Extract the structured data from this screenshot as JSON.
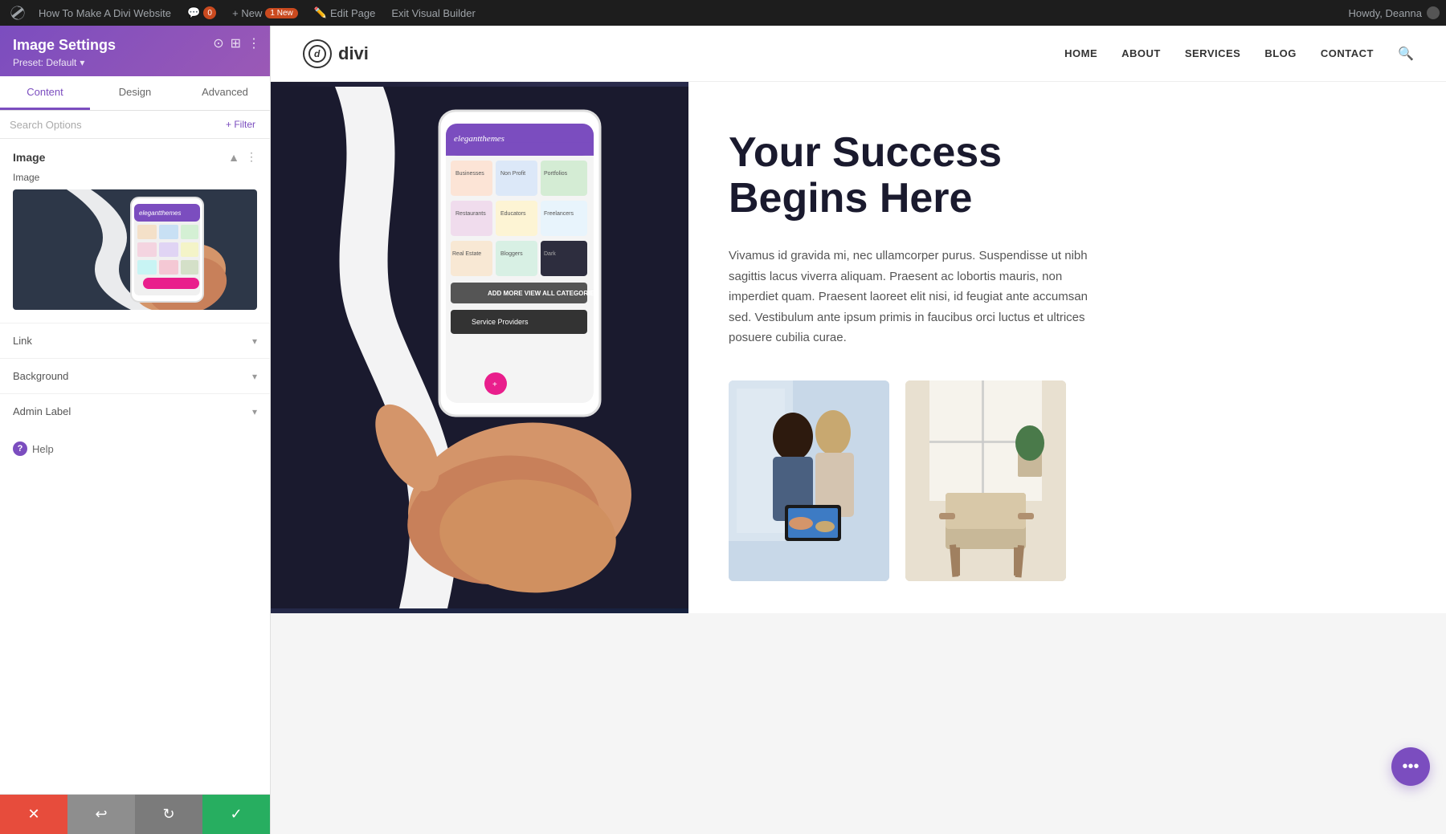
{
  "adminBar": {
    "wpLogoAlt": "WordPress",
    "siteName": "How To Make A Divi Website",
    "commentCount": "0",
    "newLabel": "+ New",
    "newBadge": "1 New",
    "editPageLabel": "Edit Page",
    "exitBuilderLabel": "Exit Visual Builder",
    "howdy": "Howdy, Deanna"
  },
  "panel": {
    "title": "Image Settings",
    "presetLabel": "Preset: Default",
    "presetChevron": "▾",
    "tabs": [
      {
        "id": "content",
        "label": "Content"
      },
      {
        "id": "design",
        "label": "Design"
      },
      {
        "id": "advanced",
        "label": "Advanced"
      }
    ],
    "activeTab": "content",
    "search": {
      "placeholder": "Search Options"
    },
    "filterLabel": "+ Filter",
    "sections": {
      "image": {
        "title": "Image",
        "imageLabel": "Image"
      },
      "link": {
        "title": "Link"
      },
      "background": {
        "title": "Background"
      },
      "adminLabel": {
        "title": "Admin Label"
      }
    },
    "helpLabel": "Help"
  },
  "toolbar": {
    "cancelIcon": "✕",
    "undoIcon": "↩",
    "redoIcon": "↻",
    "saveIcon": "✓"
  },
  "siteNav": {
    "logoText": "divi",
    "links": [
      "HOME",
      "ABOUT",
      "SERVICES",
      "BLOG",
      "CONTACT"
    ]
  },
  "hero": {
    "heading": "Your Success\nBegins Here",
    "paragraph": "Vivamus id gravida mi, nec ullamcorper purus. Suspendisse ut nibh sagittis lacus viverra aliquam. Praesent ac lobortis mauris, non imperdiet quam. Praesent laoreet elit nisi, id feugiat ante accumsan sed. Vestibulum ante ipsum primis in faucibus orci luctus et ultrices posuere cubilia curae.",
    "phoneScreenColors": [
      "#f4e0c8",
      "#c8e0f4",
      "#d4f0d4",
      "#f4d4e0",
      "#e0d4f4",
      "#f4f4c8",
      "#c8f4f4",
      "#f4c8d4",
      "#d4e0c8"
    ],
    "phoneHeaderText": "elegantthemes"
  },
  "fab": {
    "icon": "•••"
  }
}
